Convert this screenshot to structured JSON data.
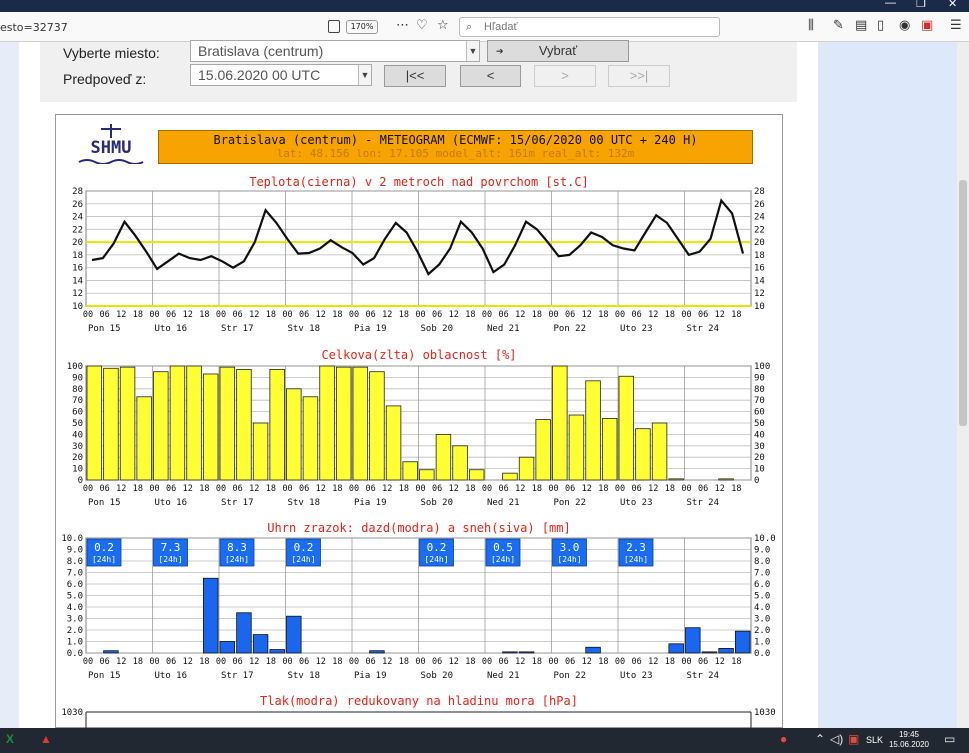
{
  "browser": {
    "url_fragment": "esto=32737",
    "zoom": "170%",
    "search_placeholder": "Hľadať"
  },
  "form": {
    "location_label": "Vyberte miesto:",
    "location_value": "Bratislava (centrum)",
    "select_button": "Vybrať",
    "forecast_label": "Predpoveď z:",
    "forecast_value": "15.06.2020 00 UTC",
    "nav": [
      "|<<",
      "<",
      ">",
      ">>|"
    ]
  },
  "meteogram": {
    "logo_text": "SHMU",
    "header_line1": "Bratislava (centrum) - METEOGRAM (ECMWF: 15/06/2020 00 UTC + 240 H)",
    "header_line2": "lat: 48.156  lon: 17.105  model_alt: 161m  real_alt: 132m",
    "days": [
      "Pon 15",
      "Uto 16",
      "Str 17",
      "Stv 18",
      "Pia 19",
      "Sob 20",
      "Ned 21",
      "Pon 22",
      "Uto 23",
      "Str 24"
    ],
    "hours": [
      "00",
      "06",
      "12",
      "18"
    ]
  },
  "chart_data": [
    {
      "type": "line",
      "title": "Teplota(cierna) v 2 metroch nad povrchom [st.C]",
      "ylim": [
        10,
        28
      ],
      "yticks": [
        10,
        12,
        14,
        16,
        18,
        20,
        22,
        24,
        26,
        28
      ],
      "reference_line": 20,
      "step_hours": 3,
      "values": [
        17.2,
        17.5,
        19.8,
        23.2,
        21.0,
        18.5,
        15.8,
        17.0,
        18.2,
        17.5,
        17.2,
        17.8,
        17.0,
        16.0,
        17.0,
        20.0,
        25.0,
        23.0,
        20.5,
        18.2,
        18.3,
        19.0,
        20.3,
        19.2,
        18.3,
        16.5,
        17.5,
        20.5,
        23.0,
        21.5,
        18.5,
        15.0,
        16.5,
        19.0,
        23.2,
        21.5,
        19.0,
        15.3,
        16.5,
        19.5,
        23.2,
        22.0,
        20.0,
        17.8,
        18.0,
        19.5,
        21.5,
        20.8,
        19.5,
        19.0,
        18.7,
        21.5,
        24.2,
        23.0,
        20.5,
        18.0,
        18.5,
        20.5,
        26.5,
        24.5,
        18.2
      ],
      "colors": {
        "line": "#111111",
        "reference": "#e6e600"
      }
    },
    {
      "type": "bar",
      "title": "Celkova(zlta) oblacnost [%]",
      "ylim": [
        0,
        100
      ],
      "yticks": [
        0,
        10,
        20,
        30,
        40,
        50,
        60,
        70,
        80,
        90,
        100
      ],
      "step_hours": 3,
      "values": [
        100,
        98,
        99,
        73,
        95,
        100,
        100,
        93,
        99,
        97,
        50,
        97,
        80,
        73,
        100,
        99,
        99,
        95,
        65,
        16,
        9,
        40,
        30,
        9,
        0,
        6,
        20,
        53,
        100,
        57,
        87,
        54,
        91,
        45,
        50,
        1,
        0,
        0,
        1,
        0
      ],
      "colors": {
        "bar": "#ffff33"
      }
    },
    {
      "type": "bar",
      "title": "Uhrn zrazok: dazd(modra) a sneh(siva) [mm]",
      "ylim": [
        0,
        10
      ],
      "yticks": [
        "0.0",
        "1.0",
        "2.0",
        "3.0",
        "4.0",
        "5.0",
        "6.0",
        "7.0",
        "8.0",
        "9.0",
        "10.0"
      ],
      "step_hours": 3,
      "values": [
        0,
        0.2,
        0,
        0,
        0,
        0,
        0,
        6.5,
        1.0,
        3.5,
        1.6,
        0.3,
        3.2,
        0,
        0,
        0,
        0,
        0.2,
        0,
        0,
        0,
        0,
        0,
        0,
        0,
        0.1,
        0.1,
        0,
        0,
        0,
        0.5,
        0,
        0,
        0,
        0,
        0.8,
        2.2,
        0.1,
        0.4,
        1.9
      ],
      "daily_totals": [
        "0.2",
        "7.3",
        "8.3",
        "0.2",
        "",
        "0.2",
        "0.5",
        "3.0",
        "2.3",
        ""
      ],
      "daily_label": "[24h]",
      "colors": {
        "bar": "#1a66ee",
        "box": "#1a6cf0"
      }
    },
    {
      "type": "line",
      "title": "Tlak(modra) redukovany na hladinu mora [hPa]",
      "yticks": [
        "1030"
      ]
    }
  ],
  "taskbar": {
    "lang": "SLK",
    "time": "19:45",
    "date": "15.06.2020"
  }
}
